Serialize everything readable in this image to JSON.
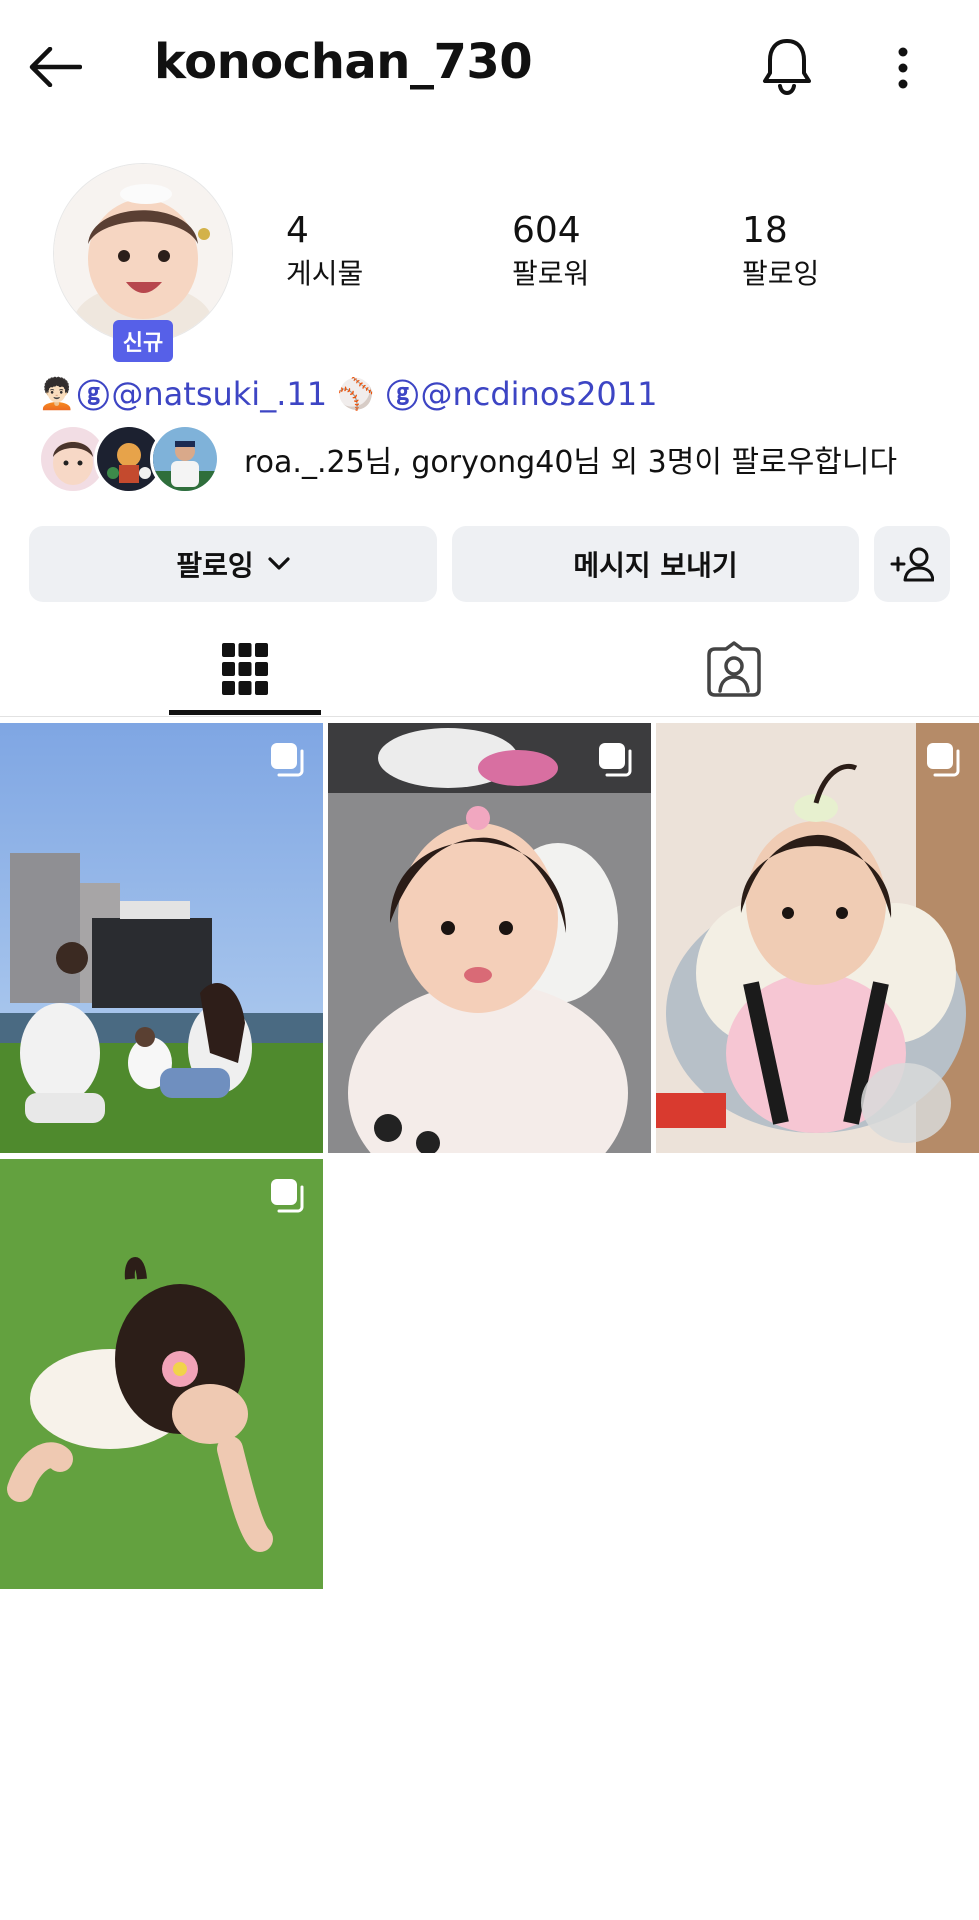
{
  "header": {
    "username": "konochan_730",
    "back_icon": "arrow-left-icon",
    "bell_icon": "bell-icon",
    "more_icon": "more-vertical-icon"
  },
  "profile": {
    "new_badge": "신규",
    "stats": [
      {
        "value": "4",
        "label": "게시물"
      },
      {
        "value": "604",
        "label": "팔로워"
      },
      {
        "value": "18",
        "label": "팔로잉"
      }
    ],
    "links": [
      {
        "emoji": "🧑🏻‍🦱",
        "handle": "@natsuki_.11"
      },
      {
        "emoji": "⚾",
        "handle": "@ncdinos2011"
      }
    ],
    "threads_symbol": "ⓖ",
    "followed_by": "roa._.25님, goryong40님 외 3명이 팔로우합니다"
  },
  "actions": {
    "following_label": "팔로잉",
    "message_label": "메시지 보내기",
    "add_person_icon": "add-person-icon"
  },
  "tabs": [
    {
      "icon": "grid-icon",
      "active": true
    },
    {
      "icon": "tagged-person-icon",
      "active": false
    }
  ],
  "colors": {
    "accent_blue": "#3d45c4",
    "badge": "#5660e8",
    "button_bg": "#eef0f3"
  }
}
